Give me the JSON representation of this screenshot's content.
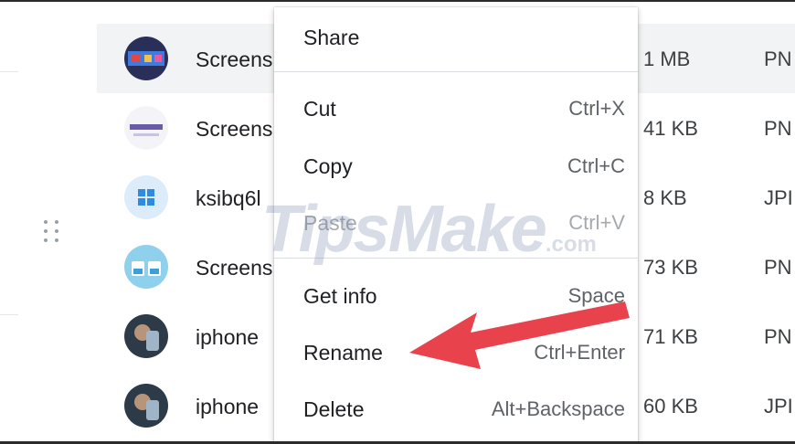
{
  "files": [
    {
      "name": "Screens",
      "size": "1 MB",
      "type": "PN",
      "thumb": "screenshot-colorful",
      "selected": true
    },
    {
      "name": "Screens",
      "size": "41 KB",
      "type": "PN",
      "thumb": "screenshot-light"
    },
    {
      "name": "ksibq6l",
      "size": "8 KB",
      "type": "JPI",
      "thumb": "windows-logo"
    },
    {
      "name": "Screens",
      "size": "73 KB",
      "type": "PN",
      "thumb": "screenshot-blue"
    },
    {
      "name": "iphone",
      "size": "71 KB",
      "type": "PN",
      "thumb": "iphone-photo"
    },
    {
      "name": "iphone",
      "size": "60 KB",
      "type": "JPI",
      "thumb": "iphone-photo"
    }
  ],
  "context_menu": {
    "share": {
      "label": "Share"
    },
    "cut": {
      "label": "Cut",
      "shortcut": "Ctrl+X"
    },
    "copy": {
      "label": "Copy",
      "shortcut": "Ctrl+C"
    },
    "paste": {
      "label": "Paste",
      "shortcut": "Ctrl+V",
      "disabled": true
    },
    "get_info": {
      "label": "Get info",
      "shortcut": "Space"
    },
    "rename": {
      "label": "Rename",
      "shortcut": "Ctrl+Enter"
    },
    "delete": {
      "label": "Delete",
      "shortcut": "Alt+Backspace"
    }
  },
  "watermark": {
    "text": "TipsMake",
    "suffix": ".com"
  },
  "colors": {
    "arrow": "#e8424c",
    "selected_row": "#f1f3f4",
    "windows_blue": "#2f8be0"
  }
}
